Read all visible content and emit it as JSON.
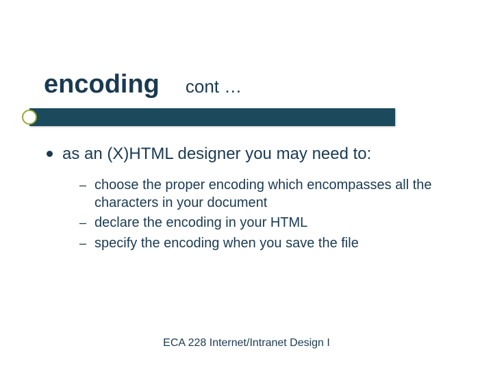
{
  "title": {
    "main": "encoding",
    "cont": "cont …"
  },
  "main_point": "as an (X)HTML designer you may need to:",
  "sub_points": [
    "choose the proper encoding which encompasses all the characters in your document",
    "declare the encoding in your HTML",
    "specify the encoding when you save the file"
  ],
  "footer": "ECA 228  Internet/Intranet Design I"
}
